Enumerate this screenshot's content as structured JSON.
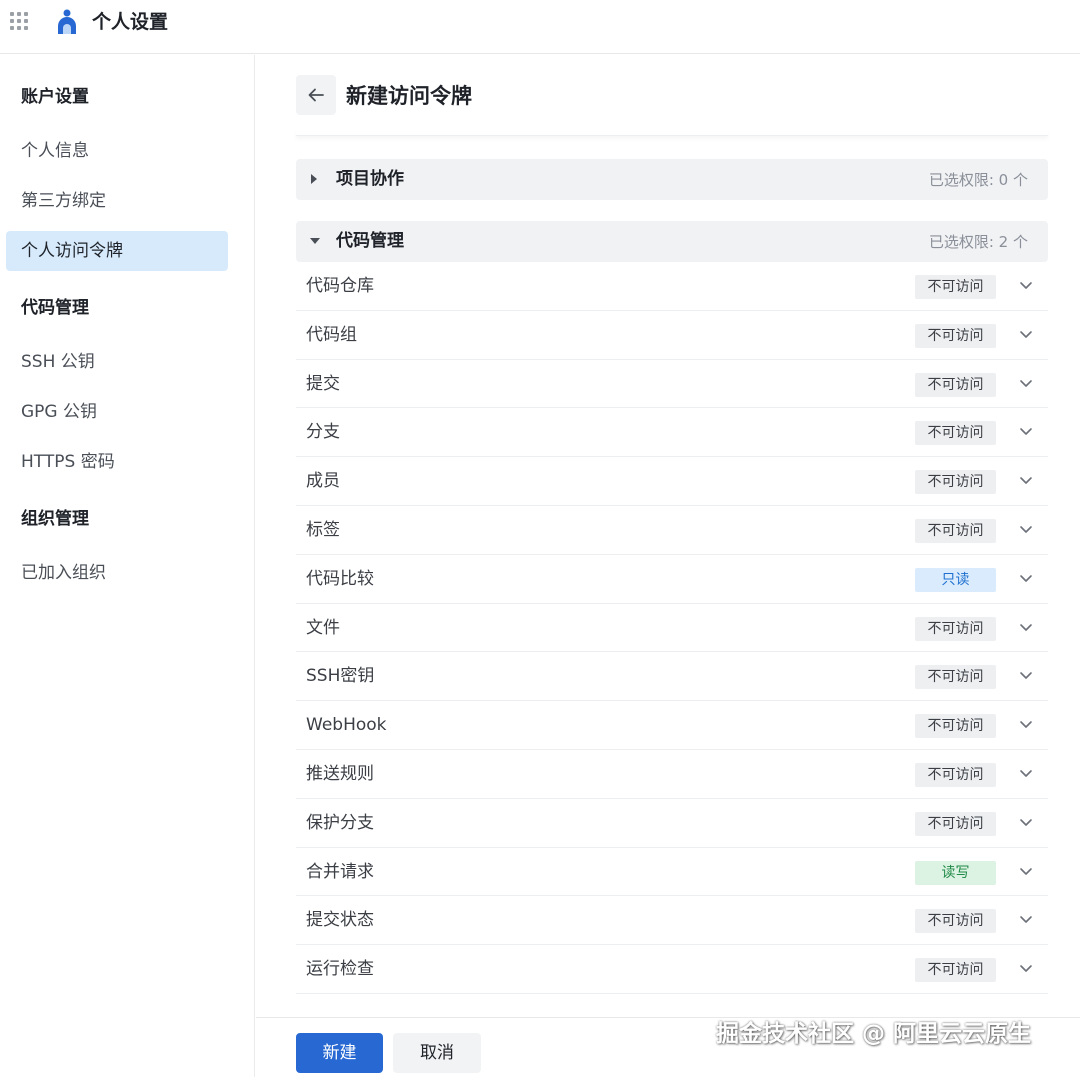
{
  "header": {
    "title": "个人设置",
    "grid_icon": "apps-grid-icon",
    "logo_icon": "logo-icon"
  },
  "sidebar": {
    "groups": [
      {
        "label": "账户设置"
      },
      {
        "label": "代码管理"
      },
      {
        "label": "组织管理"
      }
    ],
    "items": [
      {
        "label": "个人信息"
      },
      {
        "label": "第三方绑定"
      },
      {
        "label": "个人访问令牌",
        "active": true
      },
      {
        "label": "SSH 公钥"
      },
      {
        "label": "GPG 公钥"
      },
      {
        "label": "HTTPS 密码"
      },
      {
        "label": "已加入组织"
      }
    ]
  },
  "main": {
    "title": "新建访问令牌",
    "back_icon": "arrow-left-icon",
    "sections": [
      {
        "title": "项目协作",
        "count": "已选权限: 0 个",
        "expanded": false
      },
      {
        "title": "代码管理",
        "count": "已选权限: 2 个",
        "expanded": true
      }
    ],
    "permissions": [
      {
        "label": "代码仓库",
        "access": "不可访问",
        "level": "none"
      },
      {
        "label": "代码组",
        "access": "不可访问",
        "level": "none"
      },
      {
        "label": "提交",
        "access": "不可访问",
        "level": "none"
      },
      {
        "label": "分支",
        "access": "不可访问",
        "level": "none"
      },
      {
        "label": "成员",
        "access": "不可访问",
        "level": "none"
      },
      {
        "label": "标签",
        "access": "不可访问",
        "level": "none"
      },
      {
        "label": "代码比较",
        "access": "只读",
        "level": "readonly"
      },
      {
        "label": "文件",
        "access": "不可访问",
        "level": "none"
      },
      {
        "label": "SSH密钥",
        "access": "不可访问",
        "level": "none"
      },
      {
        "label": "WebHook",
        "access": "不可访问",
        "level": "none"
      },
      {
        "label": "推送规则",
        "access": "不可访问",
        "level": "none"
      },
      {
        "label": "保护分支",
        "access": "不可访问",
        "level": "none"
      },
      {
        "label": "合并请求",
        "access": "读写",
        "level": "readwrite"
      },
      {
        "label": "提交状态",
        "access": "不可访问",
        "level": "none"
      },
      {
        "label": "运行检查",
        "access": "不可访问",
        "level": "none"
      }
    ]
  },
  "footer": {
    "create_label": "新建",
    "cancel_label": "取消"
  },
  "watermark": "掘金技术社区 @ 阿里云云原生",
  "colors": {
    "accent": "#2768d3",
    "active_nav": "#d6eafc",
    "readonly": "#1e6fd0",
    "readwrite": "#1f8a46"
  }
}
